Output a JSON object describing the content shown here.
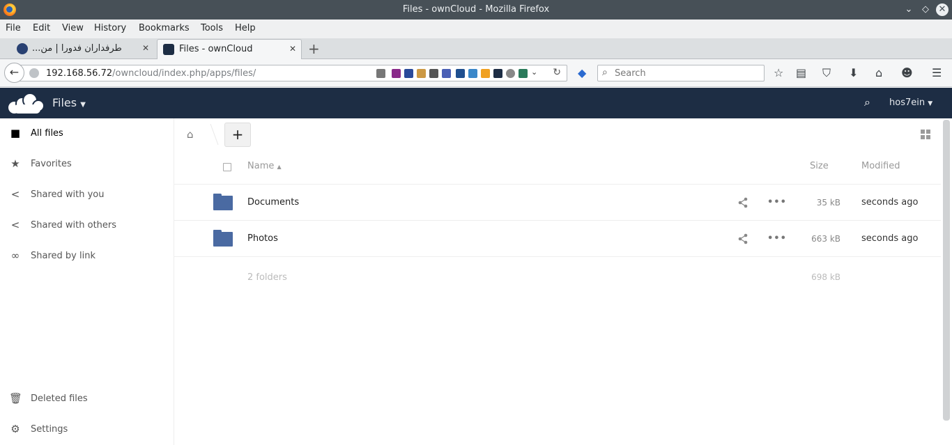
{
  "window": {
    "title": "Files - ownCloud - Mozilla Firefox"
  },
  "menubar": {
    "items": [
      "File",
      "Edit",
      "View",
      "History",
      "Bookmarks",
      "Tools",
      "Help"
    ]
  },
  "tabs": [
    {
      "label": "طرفداران فدورا | من...",
      "active": false
    },
    {
      "label": "Files - ownCloud",
      "active": true
    }
  ],
  "navbar": {
    "url_host": "192.168.56.72",
    "url_path": "/owncloud/index.php/apps/files/",
    "search_placeholder": "Search"
  },
  "app": {
    "title": "Files",
    "user": "hos7ein"
  },
  "sidebar": {
    "items": [
      {
        "label": "All files",
        "icon": "folder-icon",
        "active": true
      },
      {
        "label": "Favorites",
        "icon": "star-icon",
        "active": false
      },
      {
        "label": "Shared with you",
        "icon": "share-icon",
        "active": false
      },
      {
        "label": "Shared with others",
        "icon": "share-icon",
        "active": false
      },
      {
        "label": "Shared by link",
        "icon": "link-icon",
        "active": false
      }
    ],
    "bottom": [
      {
        "label": "Deleted files",
        "icon": "trash-icon"
      },
      {
        "label": "Settings",
        "icon": "gear-icon"
      }
    ]
  },
  "table": {
    "headers": {
      "name": "Name",
      "size": "Size",
      "modified": "Modified"
    },
    "rows": [
      {
        "name": "Documents",
        "size": "35 kB",
        "modified": "seconds ago"
      },
      {
        "name": "Photos",
        "size": "663 kB",
        "modified": "seconds ago"
      }
    ],
    "summary": {
      "count": "2 folders",
      "size": "698 kB"
    }
  },
  "colors": {
    "header_bg": "#1d2d44",
    "folder": "#4a6aa2",
    "titlebar": "#475057"
  }
}
